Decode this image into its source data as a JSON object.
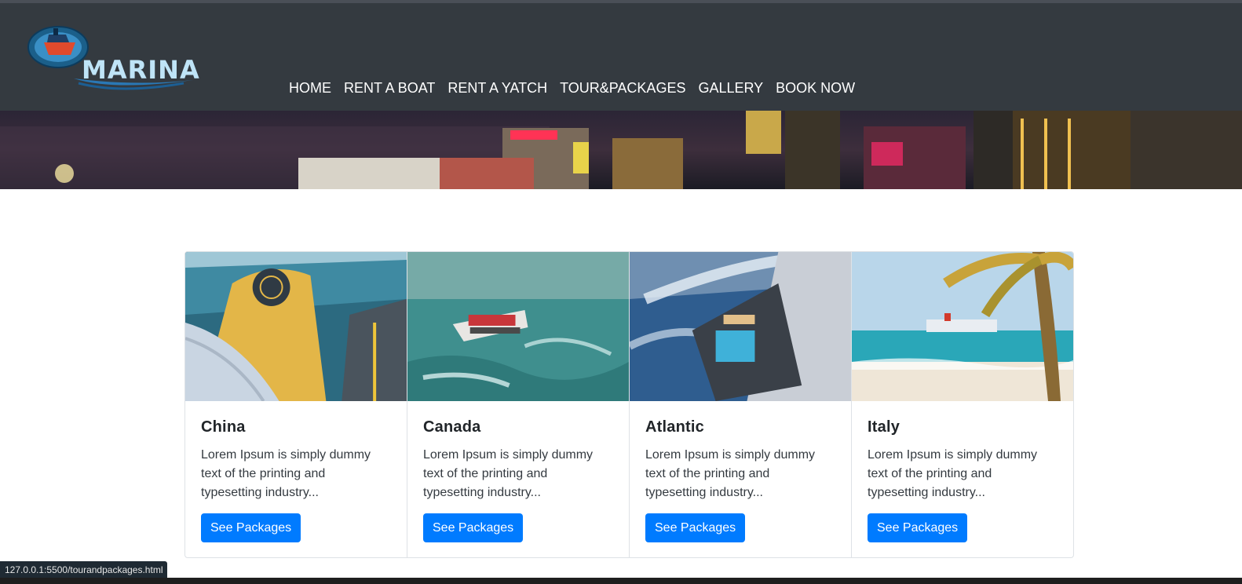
{
  "brand": {
    "name": "MARINA"
  },
  "nav": {
    "items": [
      "HOME",
      "RENT A BOAT",
      "RENT A YATCH",
      "TOUR&PACKAGES",
      "GALLERY",
      "BOOK NOW"
    ]
  },
  "cards": [
    {
      "title": "China",
      "text": "Lorem Ipsum is simply dummy text of the printing and typesetting industry...",
      "button": "See Packages"
    },
    {
      "title": "Canada",
      "text": "Lorem Ipsum is simply dummy text of the printing and typesetting industry...",
      "button": "See Packages"
    },
    {
      "title": "Atlantic",
      "text": "Lorem Ipsum is simply dummy text of the printing and typesetting industry...",
      "button": "See Packages"
    },
    {
      "title": "Italy",
      "text": "Lorem Ipsum is simply dummy text of the printing and typesetting industry...",
      "button": "See Packages"
    }
  ],
  "status_bar": {
    "url": "127.0.0.1:5500/tourandpackages.html"
  },
  "colors": {
    "navbar": "#343a40",
    "primary": "#007bff"
  }
}
